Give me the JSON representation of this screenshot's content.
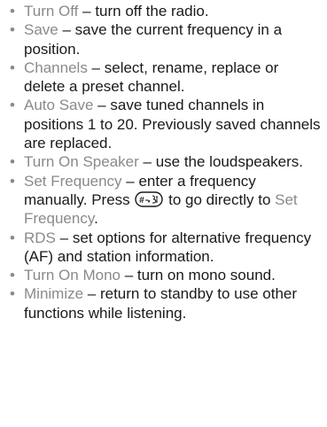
{
  "items": [
    {
      "term": "Turn Off",
      "sep": " – ",
      "desc": "turn off the radio."
    },
    {
      "term": "Save",
      "sep": " – ",
      "desc": "save the current frequency in a position."
    },
    {
      "term": "Channels",
      "sep": " – ",
      "desc": "select, rename, replace or delete a preset channel."
    },
    {
      "term": "Auto Save",
      "sep": " – ",
      "desc": "save tuned channels in positions 1 to 20. Previously saved channels are replaced."
    },
    {
      "term": "Turn On Speaker",
      "sep": " – ",
      "desc": "use the loudspeakers."
    },
    {
      "term": "Set Frequency",
      "sep": " – ",
      "desc_before_key": "enter a frequency manually. Press ",
      "key_label": "#",
      "desc_after_key": " to go directly to ",
      "link_term": "Set Frequency",
      "end": "."
    },
    {
      "term": "RDS",
      "sep": " – ",
      "desc": "set options for alternative frequency (AF) and station information."
    },
    {
      "term": "Turn On Mono",
      "sep": " – ",
      "desc": "turn on mono sound."
    },
    {
      "term": "Minimize",
      "sep": " – ",
      "desc": "return to standby to use other functions while listening."
    }
  ],
  "bullet_char": "•",
  "colors": {
    "text": "#1a1a1a",
    "term": "#8a8a8a",
    "bullet": "#8a8a8a"
  },
  "icons": {
    "key": "hash-key-icon"
  }
}
